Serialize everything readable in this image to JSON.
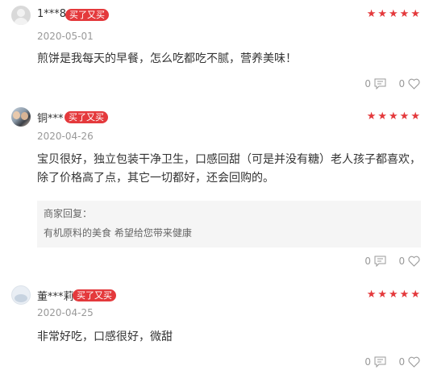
{
  "reviews": [
    {
      "user": "1***8",
      "badge": "买了又买",
      "stars": "★★★★★",
      "date": "2020-05-01",
      "content": [
        "煎饼是我每天的早餐，怎么吃都吃不腻，营养美味！"
      ],
      "comment_count": "0",
      "like_count": "0"
    },
    {
      "user": "铜***",
      "badge": "买了又买",
      "stars": "★★★★★",
      "date": "2020-04-26",
      "content": [
        "宝贝很好，独立包装干净卫生，口感回甜（可是并没有糖）老人孩子都喜欢，",
        "除了价格高了点，其它一切都好，还会回购的。"
      ],
      "reply_label": "商家回复：",
      "reply_text": "有机原料的美食 希望给您带来健康",
      "comment_count": "0",
      "like_count": "0"
    },
    {
      "user": "董***莉",
      "badge": "买了又买",
      "stars": "★★★★★",
      "date": "2020-04-25",
      "content": [
        "非常好吃，口感很好，微甜"
      ],
      "comment_count": "0",
      "like_count": "0"
    }
  ],
  "colors": {
    "accent": "#e4393c",
    "muted": "#999999",
    "reply_bg": "#f5f5f5"
  },
  "icons": {
    "comment": "comment-icon",
    "like": "heart-icon"
  }
}
